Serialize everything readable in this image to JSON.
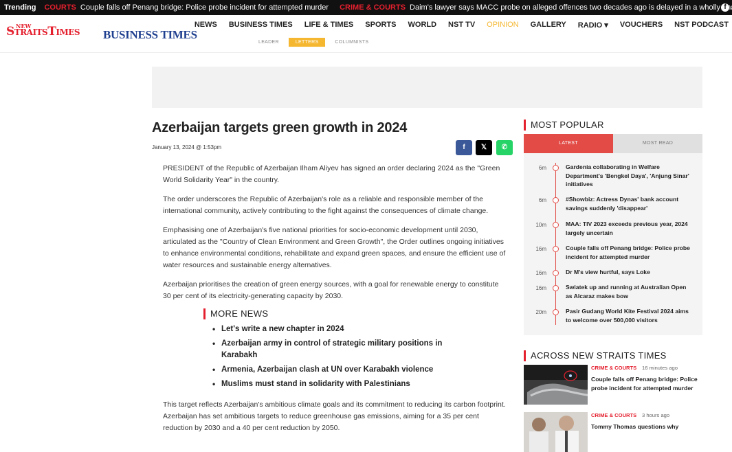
{
  "trending": {
    "label": "Trending",
    "items": [
      {
        "category": "COURTS",
        "text": "Couple falls off Penang bridge: Police probe incident for attempted murder"
      },
      {
        "category": "CRIME & COURTS",
        "text": "Daim's lawyer says MACC probe on alleged offences two decades ago is delayed in a wholly unacı"
      }
    ],
    "social_icon": "facebook-icon"
  },
  "header": {
    "logo_nst_small": "NEW",
    "logo_nst": "StraitsTimes",
    "logo_bt": "BUSINESS TIMES",
    "nav": [
      "NEWS",
      "BUSINESS TIMES",
      "LIFE & TIMES",
      "SPORTS",
      "WORLD",
      "NST TV",
      "OPINION",
      "GALLERY",
      "RADIO ▾",
      "VOUCHERS",
      "NST PODCAST"
    ],
    "nav_active": "OPINION",
    "subnav": [
      "LEADER",
      "LETTERS",
      "COLUMNISTS"
    ],
    "subnav_active": "LETTERS",
    "accent": "#f5b730"
  },
  "article": {
    "title": "Azerbaijan targets green growth in 2024",
    "date": "January 13, 2024 @ 1:53pm",
    "share": {
      "facebook": "f",
      "x": "𝕏",
      "whatsapp": "✆"
    },
    "paragraphs": [
      "PRESIDENT of the Republic of Azerbaijan Ilham Aliyev has signed an order declaring 2024 as the \"Green World Solidarity Year\" in the country.",
      "The order underscores the Republic of Azerbaijan's role as a reliable and responsible member of the international community, actively contributing to the fight against the consequences of climate change.",
      "Emphasising one of Azerbaijan's five national priorities for socio-economic development until 2030, articulated as the \"Country of Clean Environment and Green Growth\", the Order outlines ongoing initiatives to enhance environmental conditions, rehabilitate and expand green spaces, and ensure the efficient use of water resources and sustainable energy alternatives.",
      "Azerbaijan prioritises the creation of green energy sources, with a goal for renewable energy to constitute 30 per cent of its electricity-generating capacity by 2030."
    ],
    "more_news": {
      "heading": "MORE NEWS",
      "items": [
        "Let's write a new chapter in 2024",
        "Azerbaijan army in control of strategic military positions in Karabakh",
        "Armenia, Azerbaijan clash at UN over Karabakh violence",
        "Muslims must stand in solidarity with Palestinians"
      ]
    },
    "paragraph_after": "This target reflects Azerbaijan's ambitious climate goals and its commitment to reducing its carbon footprint. Azerbaijan has set ambitious targets to reduce greenhouse gas emissions, aiming for a 35 per cent reduction by 2030 and a 40 per cent reduction by 2050."
  },
  "most_popular": {
    "heading": "MOST POPULAR",
    "tabs": [
      "LATEST",
      "MOST READ"
    ],
    "active_tab": "LATEST",
    "items": [
      {
        "time": "6m",
        "headline": "Gardenia collaborating in Welfare Department's 'Bengkel Daya', 'Anjung Sinar' initiatives"
      },
      {
        "time": "6m",
        "headline": "#Showbiz: Actress Dynas' bank account savings suddenly 'disappear'"
      },
      {
        "time": "10m",
        "headline": "MAA: TIV 2023 exceeds previous year, 2024 largely uncertain"
      },
      {
        "time": "16m",
        "headline": "Couple falls off Penang bridge: Police probe incident for attempted murder"
      },
      {
        "time": "16m",
        "headline": "Dr M's view hurtful, says Loke"
      },
      {
        "time": "16m",
        "headline": "Swiatek up and running at Australian Open as Alcaraz makes bow"
      },
      {
        "time": "20m",
        "headline": "Pasir Gudang World Kite Festival 2024 aims to welcome over 500,000 visitors"
      }
    ],
    "accent": "#e24b46"
  },
  "across": {
    "heading": "ACROSS NEW STRAITS TIMES",
    "items": [
      {
        "category": "CRIME & COURTS",
        "time": "16 minutes ago",
        "headline": "Couple falls off Penang bridge: Police probe incident for attempted murder"
      },
      {
        "category": "CRIME & COURTS",
        "time": "3 hours ago",
        "headline": "Tommy Thomas questions why"
      }
    ]
  }
}
